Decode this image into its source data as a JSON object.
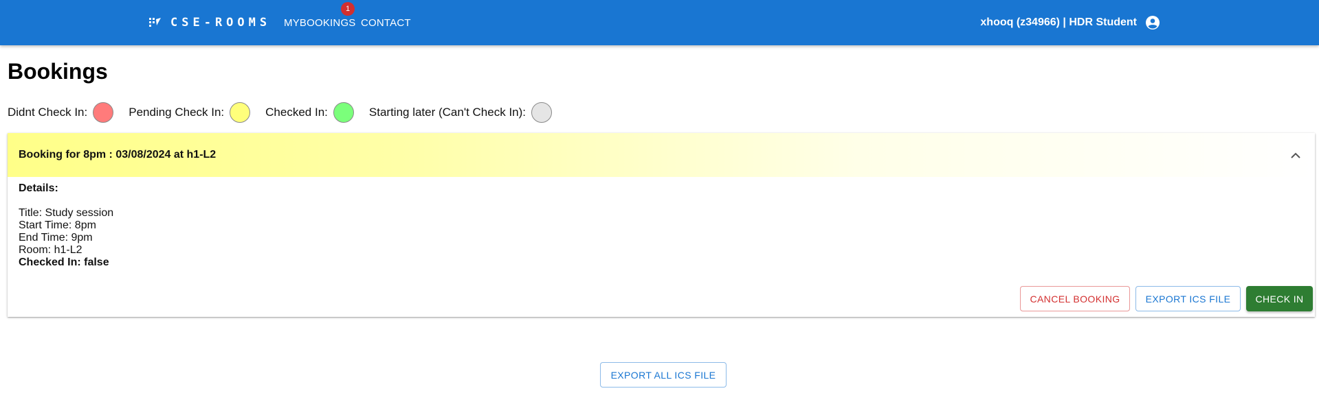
{
  "appbar": {
    "brand": "CSE-ROOMS",
    "nav": {
      "mybookings": "MyBookings",
      "contact": "Contact"
    },
    "badge_count": "1",
    "user": "xhooq (z34966) | HDR Student",
    "color": "#1976d2"
  },
  "page": {
    "title": "Bookings"
  },
  "legend": [
    {
      "label": "Didnt Check In:",
      "color": "#ff7b7b"
    },
    {
      "label": "Pending Check In:",
      "color": "#ffff7b"
    },
    {
      "label": "Checked In:",
      "color": "#7bff7b"
    },
    {
      "label": "Starting later (Can't Check In):",
      "color": "#e5e5e5"
    }
  ],
  "booking": {
    "header": "Booking for 8pm : 03/08/2024 at h1-L2",
    "details_heading": "Details:",
    "title": "Title: Study session",
    "start": "Start Time: 8pm",
    "end": "End Time: 9pm",
    "room": "Room: h1-L2",
    "checked_in": "Checked In: false",
    "actions": {
      "cancel": "Cancel Booking",
      "export": "Export ICS File",
      "checkin": "Check In"
    }
  },
  "footer": {
    "export_all": "Export All ICS File"
  },
  "icons": {
    "brand": "grid-icon",
    "user": "account-circle-icon",
    "chevron": "chevron-up-icon"
  }
}
